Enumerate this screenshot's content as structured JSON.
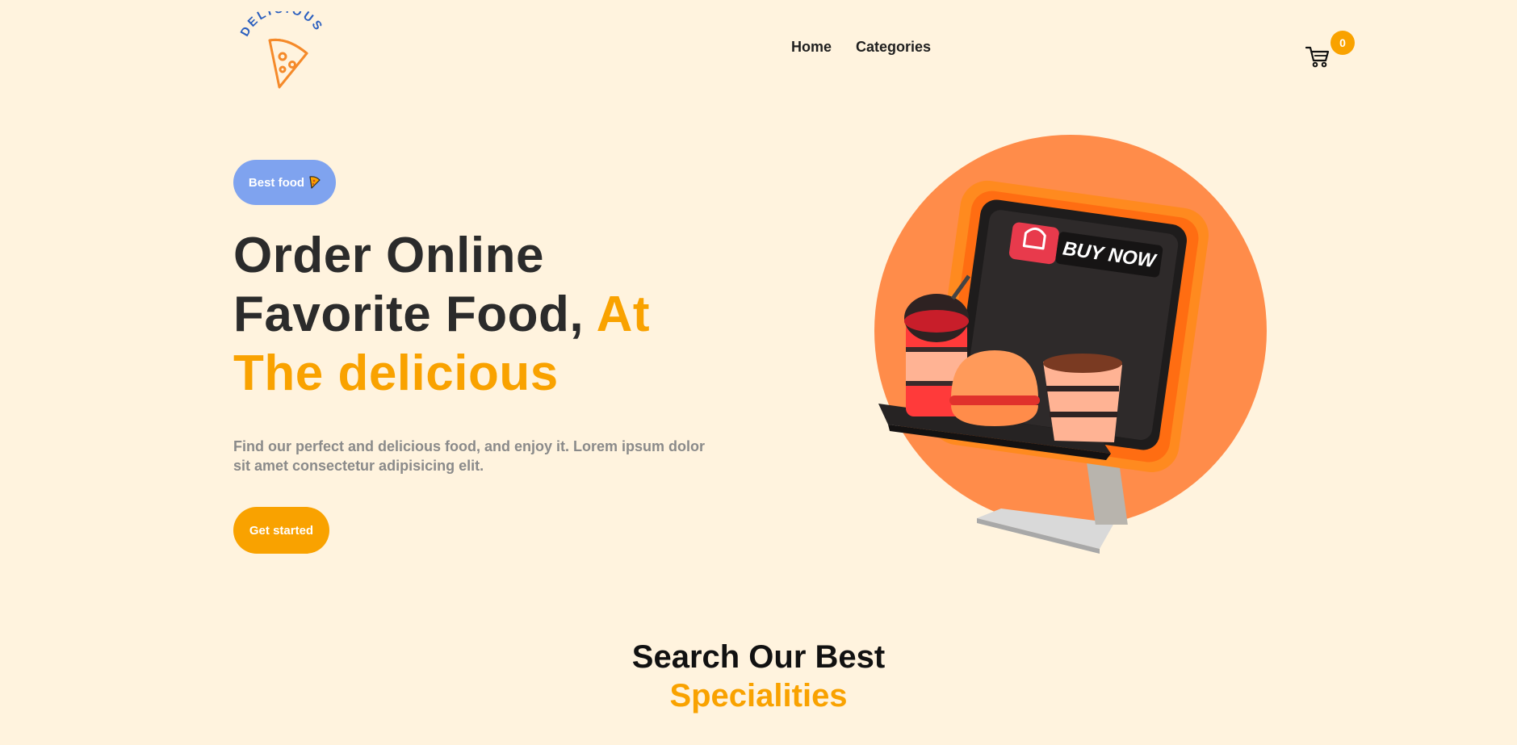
{
  "brand": {
    "logo_text": "DELICIOUS"
  },
  "nav": {
    "items": [
      {
        "label": "Home"
      },
      {
        "label": "Categories"
      }
    ]
  },
  "cart": {
    "count": "0"
  },
  "hero": {
    "badge_label": "Best food",
    "headline": {
      "part1": "Order Online Favorite Food,",
      "accent": "At The delicious"
    },
    "description": "Find our perfect and delicious food, and enjoy it. Lorem ipsum dolor sit amet consectetur adipisicing elit.",
    "cta_label": "Get started",
    "sign_text": "BUY NOW"
  },
  "section": {
    "title_line1": "Search Our Best",
    "title_line2": "Specialities"
  },
  "colors": {
    "background": "#fff3de",
    "accent": "#f9a200",
    "badge_blue": "#7fa3ef",
    "circle": "#ff8c4a"
  }
}
